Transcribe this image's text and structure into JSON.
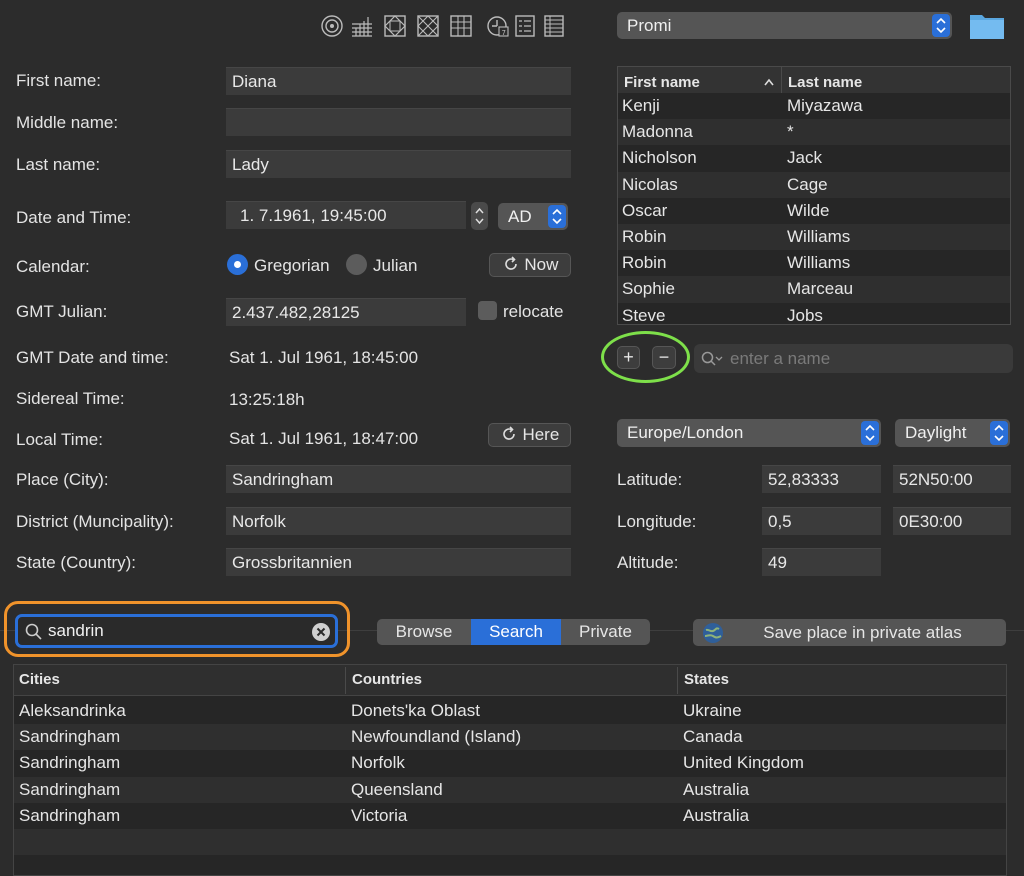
{
  "toolbar": {
    "icons": [
      "target-icon",
      "bar-grid-icon",
      "square-grid-icon",
      "diamond-grid-icon",
      "table-grid-icon",
      "clock-seven-icon",
      "list-icon",
      "sheet-icon"
    ]
  },
  "group_select": {
    "value": "Promi"
  },
  "form": {
    "first_name_label": "First name:",
    "first_name": "Diana",
    "middle_name_label": "Middle name:",
    "middle_name": "",
    "last_name_label": "Last name:",
    "last_name": "Lady",
    "datetime_label": "Date and Time:",
    "datetime": "1.  7.1961, 19:45:00",
    "era": "AD",
    "calendar_label": "Calendar:",
    "calendar_gregorian": "Gregorian",
    "calendar_julian": "Julian",
    "now_button": "Now",
    "gmt_julian_label": "GMT Julian:",
    "gmt_julian": "2.437.482,28125",
    "relocate": "relocate",
    "gmt_datetime_label": "GMT Date and time:",
    "gmt_datetime": "Sat 1. Jul 1961, 18:45:00",
    "sidereal_label": "Sidereal Time:",
    "sidereal": "13:25:18h",
    "local_label": "Local Time:",
    "local_time": "Sat 1. Jul 1961, 18:47:00",
    "here_button": "Here",
    "place_label": "Place (City):",
    "place": "Sandringham",
    "district_label": "District (Muncipality):",
    "district": "Norfolk",
    "state_label": "State (Country):",
    "state": "Grossbritannien"
  },
  "people": {
    "col_first": "First name",
    "col_last": "Last name",
    "sort_indicator": "^",
    "rows": [
      {
        "first": "Kenji",
        "last": "Miyazawa"
      },
      {
        "first": "Madonna",
        "last": "*"
      },
      {
        "first": "Nicholson",
        "last": "Jack"
      },
      {
        "first": "Nicolas",
        "last": "Cage"
      },
      {
        "first": "Oscar",
        "last": "Wilde"
      },
      {
        "first": "Robin",
        "last": "Williams"
      },
      {
        "first": "Robin",
        "last": "Williams"
      },
      {
        "first": "Sophie",
        "last": "Marceau"
      },
      {
        "first": "Steve",
        "last": "Jobs"
      }
    ],
    "add_label": "+",
    "remove_label": "−",
    "search_placeholder": "enter a name"
  },
  "location": {
    "timezone": "Europe/London",
    "dst": "Daylight",
    "latitude_label": "Latitude:",
    "latitude": "52,83333",
    "latitude_dms": "52N50:00",
    "longitude_label": "Longitude:",
    "longitude": "0,5",
    "longitude_dms": "0E30:00",
    "altitude_label": "Altitude:",
    "altitude": "49"
  },
  "atlas": {
    "search_value": "sandrin",
    "tabs": [
      "Browse",
      "Search",
      "Private"
    ],
    "active_tab": "Search",
    "save_button": "Save place in private atlas",
    "columns": [
      "Cities",
      "Countries",
      "States"
    ],
    "rows": [
      [
        "Aleksandrinka",
        "Donets'ka Oblast",
        "Ukraine"
      ],
      [
        "Sandringham",
        "Newfoundland (Island)",
        "Canada"
      ],
      [
        "Sandringham",
        "Norfolk",
        "United Kingdom"
      ],
      [
        "Sandringham",
        "Queensland",
        "Australia"
      ],
      [
        "Sandringham",
        "Victoria",
        "Australia"
      ]
    ]
  },
  "colors": {
    "accent": "#2a6fd8",
    "highlight_green": "#7ee04a",
    "highlight_orange": "#f0932b"
  }
}
